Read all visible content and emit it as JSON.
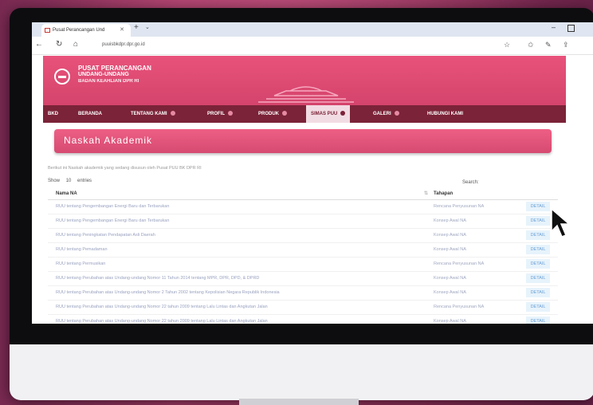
{
  "browser": {
    "tab_title": "Pusat Perancangan Und",
    "url": "puuisbkdpr.dpr.go.id"
  },
  "site": {
    "brand_line1": "PUSAT PERANCANGAN",
    "brand_line2": "UNDANG-UNDANG",
    "brand_line3": "BADAN KEAHLIAN DPR RI"
  },
  "nav": {
    "items": [
      {
        "label": "BKD",
        "has_dropdown": false
      },
      {
        "label": "BERANDA",
        "has_dropdown": false
      },
      {
        "label": "TENTANG KAMI",
        "has_dropdown": true
      },
      {
        "label": "PROFIL",
        "has_dropdown": true
      },
      {
        "label": "PRODUK",
        "has_dropdown": true
      },
      {
        "label": "SIMAS PUU",
        "has_dropdown": true,
        "active": true
      },
      {
        "label": "GALERI",
        "has_dropdown": true
      },
      {
        "label": "HUBUNGI KAMI",
        "has_dropdown": false
      }
    ]
  },
  "page": {
    "title": "Naskah Akademik",
    "intro": "Berikut ini Naskah akademik yang sedang disusun oleh Pusat PUU BK DPR RI",
    "show_label": "Show",
    "show_value": "10",
    "entries_label": "entries",
    "search_label": "Search:"
  },
  "table": {
    "columns": [
      "Nama NA",
      "Tahapan"
    ],
    "rows": [
      {
        "nama": "RUU tentang Pengembangan Energi Baru dan Terbarukan",
        "tahapan": "Rencana Penyusunan NA",
        "action": "DETAIL"
      },
      {
        "nama": "RUU tentang Pengembangan Energi Baru dan Terbarukan",
        "tahapan": "Konsep Awal NA",
        "action": "DETAIL"
      },
      {
        "nama": "RUU tentang Peningkatan Pendapatan Asli Daerah",
        "tahapan": "Konsep Awal NA",
        "action": "DETAIL"
      },
      {
        "nama": "RUU tentang Pemadaman",
        "tahapan": "Konsep Awal NA",
        "action": "DETAIL"
      },
      {
        "nama": "RUU tentang Permusikan",
        "tahapan": "Rencana Penyusunan NA",
        "action": "DETAIL"
      },
      {
        "nama": "RUU tentang Perubahan atas Undang-undang Nomor 11 Tahun 2014 tentang MPR, DPR, DPD, & DPRD",
        "tahapan": "Konsep Awal NA",
        "action": "DETAIL"
      },
      {
        "nama": "RUU tentang Perubahan atas Undang-undang Nomor 2 Tahun 2002 tentang Kepolisian Negara Republik Indonesia",
        "tahapan": "Konsep Awal NA",
        "action": "DETAIL"
      },
      {
        "nama": "RUU tentang Perubahan atas Undang-undang Nomor 22 tahun 2009 tentang Lalu Lintas dan Angkutan Jalan",
        "tahapan": "Rencana Penyusunan NA",
        "action": "DETAIL"
      },
      {
        "nama": "RUU tentang Perubahan atas Undang-undang Nomor 22 tahun 2009 tentang Lalu Lintas dan Angkutan Jalan",
        "tahapan": "Konsep Awal NA",
        "action": "DETAIL"
      }
    ]
  },
  "colors": {
    "brand_pink": "#e8527a",
    "nav_maroon": "#7b2338",
    "link_blue": "#6aa0d8"
  }
}
